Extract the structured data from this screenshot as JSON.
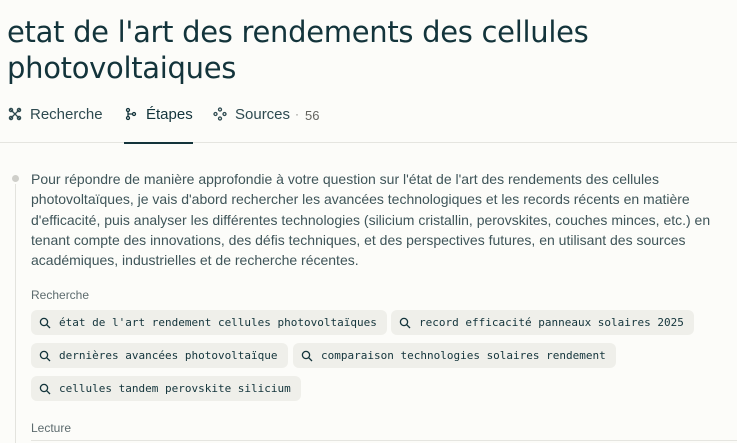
{
  "page": {
    "title": "etat de l'art des rendements des cellules photovoltaiques"
  },
  "tabs": [
    {
      "label": "Recherche",
      "icon": "research-icon"
    },
    {
      "label": "Étapes",
      "icon": "steps-icon",
      "active": true
    },
    {
      "label": "Sources",
      "icon": "sources-icon",
      "count": "56"
    }
  ],
  "step": {
    "description": "Pour répondre de manière approfondie à votre question sur l'état de l'art des rendements des cellules photovoltaïques, je vais d'abord rechercher les avancées technologiques et les records récents en matière d'efficacité, puis analyser les différentes technologies (silicium cristallin, perovskites, couches minces, etc.) en tenant compte des innovations, des défis techniques, et des perspectives futures, en utilisant des sources académiques, industrielles et de recherche récentes.",
    "search_label": "Recherche",
    "queries": [
      "état de l'art rendement cellules photovoltaïques",
      "record efficacité panneaux solaires 2025",
      "dernières avancées photovoltaïque",
      "comparaison technologies solaires rendement",
      "cellules tandem perovskite silicium"
    ],
    "reading_label": "Lecture"
  },
  "colors": {
    "text": "#13343b",
    "chip_bg": "#efefea",
    "background": "#fcfcf9"
  }
}
